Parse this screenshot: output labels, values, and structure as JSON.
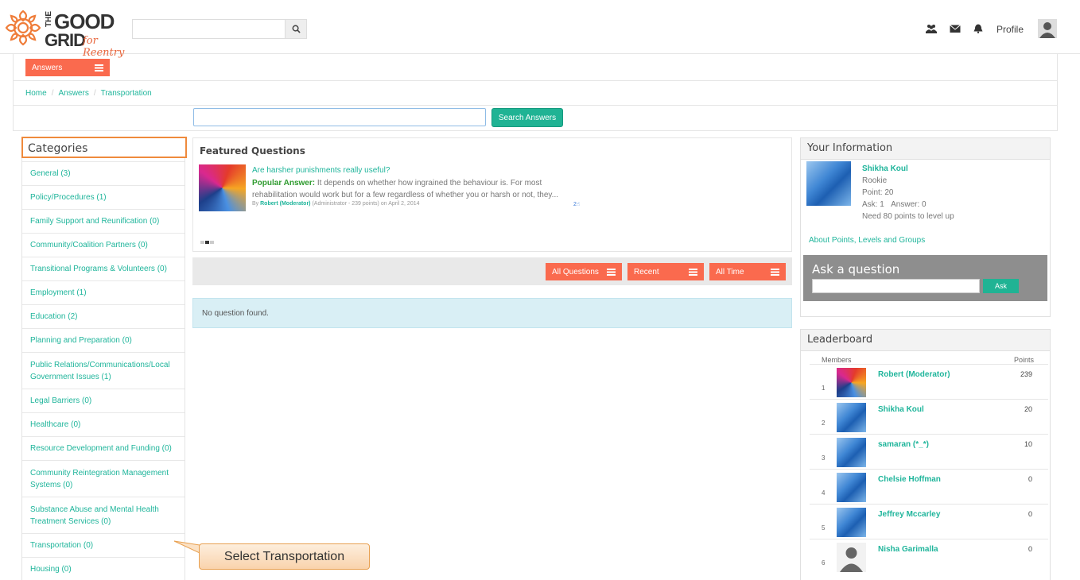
{
  "header": {
    "logo_the": "THE",
    "logo_good": "GOOD",
    "logo_grid": "GRID",
    "logo_tagline": "for Reentry",
    "search_placeholder": "",
    "profile_label": "Profile",
    "icons": [
      "users-icon",
      "envelope-icon",
      "bell-icon",
      "search-icon",
      "avatar-icon"
    ]
  },
  "nav": {
    "answers_label": "Answers"
  },
  "breadcrumb": {
    "home": "Home",
    "answers": "Answers",
    "current": "Transportation",
    "separator": "/"
  },
  "answers_search": {
    "value": "",
    "button_label": "Search Answers"
  },
  "categories": {
    "title": "Categories",
    "items": [
      "General (3)",
      "Policy/Procedures (1)",
      "Family Support and Reunification (0)",
      "Community/Coalition Partners (0)",
      "Transitional Programs & Volunteers (0)",
      "Employment (1)",
      "Education (2)",
      "Planning and Preparation (0)",
      "Public Relations/Communications/Local Government Issues (1)",
      "Legal Barriers (0)",
      "Healthcare (0)",
      "Resource Development and Funding (0)",
      "Community Reintegration Management Systems (0)",
      "Substance Abuse and Mental Health Treatment Services (0)",
      "Transportation (0)",
      "Housing (0)"
    ]
  },
  "callout": {
    "text": "Select Transportation"
  },
  "featured": {
    "title": "Featured Questions",
    "question": "Are harsher punishments really useful?",
    "popular_label": "Popular Answer:",
    "answer": "It depends on whether how ingrained the behaviour is. For most rehabilitation would work but for a few regardless of whether you or harsh or not, they...",
    "meta_by": "By",
    "meta_author": "Robert (Moderator)",
    "meta_role": "(Administrator - 239 points)",
    "meta_date": "on April 2, 2014",
    "likes": "2"
  },
  "filters": {
    "all_questions": "All Questions",
    "recent": "Recent",
    "all_time": "All Time"
  },
  "no_question": "No question found.",
  "your_info": {
    "title": "Your Information",
    "name": "Shikha Koul",
    "rank": "Rookie",
    "points": "Point: 20",
    "ask": "Ask: 1",
    "answer": "Answer: 0",
    "need": "Need 80 points to level up",
    "about_link": "About Points, Levels and Groups",
    "ask_title": "Ask a question",
    "ask_button": "Ask"
  },
  "leaderboard": {
    "title": "Leaderboard",
    "members_header": "Members",
    "points_header": "Points",
    "rows": [
      {
        "rank": "1",
        "name": "Robert (Moderator)",
        "points": "239",
        "avatar": "art"
      },
      {
        "rank": "2",
        "name": "Shikha Koul",
        "points": "20",
        "avatar": "blue"
      },
      {
        "rank": "3",
        "name": "samaran (*_*)",
        "points": "10",
        "avatar": "blue"
      },
      {
        "rank": "4",
        "name": "Chelsie Hoffman",
        "points": "0",
        "avatar": "blue"
      },
      {
        "rank": "5",
        "name": "Jeffrey Mccarley",
        "points": "0",
        "avatar": "blue"
      },
      {
        "rank": "6",
        "name": "Nisha Garimalla",
        "points": "0",
        "avatar": "gray"
      }
    ]
  },
  "colors": {
    "accent_orange": "#fa6a4e",
    "accent_teal": "#1fb59b",
    "button_green": "#20b394",
    "callout_border": "#e8a050"
  }
}
